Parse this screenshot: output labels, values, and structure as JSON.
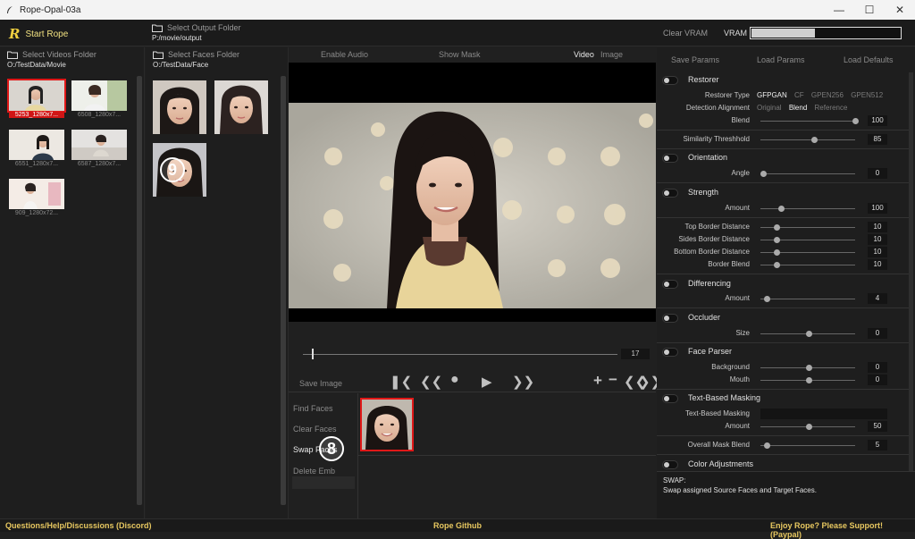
{
  "window": {
    "title": "Rope-Opal-03a",
    "controls": [
      "minimize",
      "maximize",
      "close"
    ]
  },
  "topbar": {
    "start_label": "Start Rope",
    "output_folder_label": "Select Output Folder",
    "output_folder_path": "P:/movie/output",
    "clear_vram": "Clear VRAM",
    "vram_label": "VRAM",
    "vram_usage_fraction": 0.42
  },
  "videos_panel": {
    "button_label": "Select Videos Folder",
    "path": "O:/TestData/Movie",
    "items": [
      {
        "caption": "5253_1280x7...",
        "selected": true
      },
      {
        "caption": "6508_1280x7...",
        "selected": false
      },
      {
        "caption": "6551_1280x7...",
        "selected": false
      },
      {
        "caption": "6587_1280x7...",
        "selected": false
      },
      {
        "caption": "909_1280x72...",
        "selected": false
      }
    ]
  },
  "faces_panel": {
    "button_label": "Select Faces Folder",
    "path": "O:/TestData/Face",
    "annotation": "9"
  },
  "center": {
    "toolbar": {
      "enable_audio": "Enable Audio",
      "show_mask": "Show Mask",
      "video": "Video",
      "image": "Image"
    },
    "frame_number": "17",
    "save_image": "Save Image",
    "face_ops": {
      "find": "Find Faces",
      "clear": "Clear Faces",
      "swap": "Swap Faces",
      "delete": "Delete Emb"
    },
    "annotation": "8"
  },
  "right_panel": {
    "save_params": "Save Params",
    "load_params": "Load Params",
    "load_defaults": "Load Defaults",
    "restorer": {
      "title": "Restorer",
      "type_label": "Restorer Type",
      "types": [
        "GFPGAN",
        "CF",
        "GPEN256",
        "GPEN512"
      ],
      "selected_type": "GFPGAN",
      "alignment_label": "Detection Alignment",
      "alignments": [
        "Original",
        "Blend",
        "Reference"
      ],
      "selected_alignment": "Blend",
      "blend_label": "Blend",
      "blend_value": "100"
    },
    "similarity": {
      "label": "Similarity Threshhold",
      "value": "85"
    },
    "orientation": {
      "title": "Orientation",
      "angle_label": "Angle",
      "angle_value": "0"
    },
    "strength": {
      "title": "Strength",
      "amount_label": "Amount",
      "amount_value": "100",
      "top_label": "Top Border Distance",
      "top_value": "10",
      "sides_label": "Sides Border Distance",
      "sides_value": "10",
      "bottom_label": "Bottom Border Distance",
      "bottom_value": "10",
      "blend_label": "Border Blend",
      "blend_value": "10"
    },
    "differencing": {
      "title": "Differencing",
      "amount_label": "Amount",
      "amount_value": "4"
    },
    "occluder": {
      "title": "Occluder",
      "size_label": "Size",
      "size_value": "0"
    },
    "face_parser": {
      "title": "Face Parser",
      "background_label": "Background",
      "background_value": "0",
      "mouth_label": "Mouth",
      "mouth_value": "0"
    },
    "text_masking": {
      "title": "Text-Based Masking",
      "field_label": "Text-Based Masking",
      "amount_label": "Amount",
      "amount_value": "50"
    },
    "overall_blend": {
      "label": "Overall Mask Blend",
      "value": "5"
    },
    "color_adjustments": {
      "title": "Color Adjustments"
    },
    "help_title": "SWAP:",
    "help_text": "Swap assigned Source Faces and Target Faces."
  },
  "bottombar": {
    "discord": "Questions/Help/Discussions (Discord)",
    "github": "Rope Github",
    "support": "Enjoy Rope? Please Support! (Paypal)"
  },
  "colors": {
    "accent_red": "#e01818",
    "accent_yellow": "#e8c860"
  }
}
